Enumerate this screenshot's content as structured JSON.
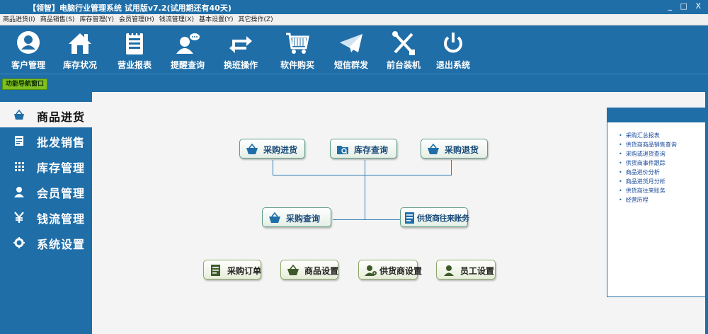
{
  "window": {
    "title": "【领智】电脑行业管理系统 试用版v7.2(试用期还有40天)",
    "controls": {
      "minimize": "_",
      "restore": "□",
      "close": "X"
    }
  },
  "menu": [
    "商品进货(I)",
    "商品销售(S)",
    "库存管理(Y)",
    "会员管理(H)",
    "钱流管理(X)",
    "基本设置(Y)",
    "其它操作(Z)"
  ],
  "toolbar": [
    {
      "label": "客户管理",
      "icon": "customer-icon"
    },
    {
      "label": "库存状况",
      "icon": "home-icon"
    },
    {
      "label": "营业报表",
      "icon": "notepad-icon"
    },
    {
      "label": "提醒查询",
      "icon": "user-chat-icon"
    },
    {
      "label": "换班操作",
      "icon": "swap-arrows-icon"
    },
    {
      "label": "软件购买",
      "icon": "cart-icon"
    },
    {
      "label": "短信群发",
      "icon": "envelope-icon"
    },
    {
      "label": "前台装机",
      "icon": "tools-icon"
    },
    {
      "label": "退出系统",
      "icon": "power-icon"
    }
  ],
  "nav_tag": "功能导航窗口",
  "sidebar": [
    {
      "label": "商品进货",
      "icon": "basket-icon",
      "active": true
    },
    {
      "label": "批发销售",
      "icon": "ledger-icon",
      "active": false
    },
    {
      "label": "库存管理",
      "icon": "grid-icon",
      "active": false
    },
    {
      "label": "会员管理",
      "icon": "person-icon",
      "active": false
    },
    {
      "label": "钱流管理",
      "icon": "yen-icon",
      "active": false
    },
    {
      "label": "系统设置",
      "icon": "gear-icon",
      "active": false
    }
  ],
  "flow": {
    "purchase": "采购进货",
    "stock_query": "库存查询",
    "purchase_return": "采购退货",
    "purchase_query": "采购查询",
    "supplier_accounts": "供货商往来账务"
  },
  "quick": {
    "purchase_order": "采购订单",
    "product_settings": "商品设置",
    "supplier_settings": "供货商设置",
    "staff_settings": "员工设置"
  },
  "links": [
    "采购汇总报表",
    "供货商商品销售查询",
    "采购或退货查询",
    "供货商事件跟踪",
    "商品进价分析",
    "商品进货月分析",
    "供货商往来账务",
    "经营历程"
  ],
  "colors": {
    "brand": "#1f6ea8",
    "nav_tag": "#7fbf1f",
    "link": "#1a4a9a"
  }
}
